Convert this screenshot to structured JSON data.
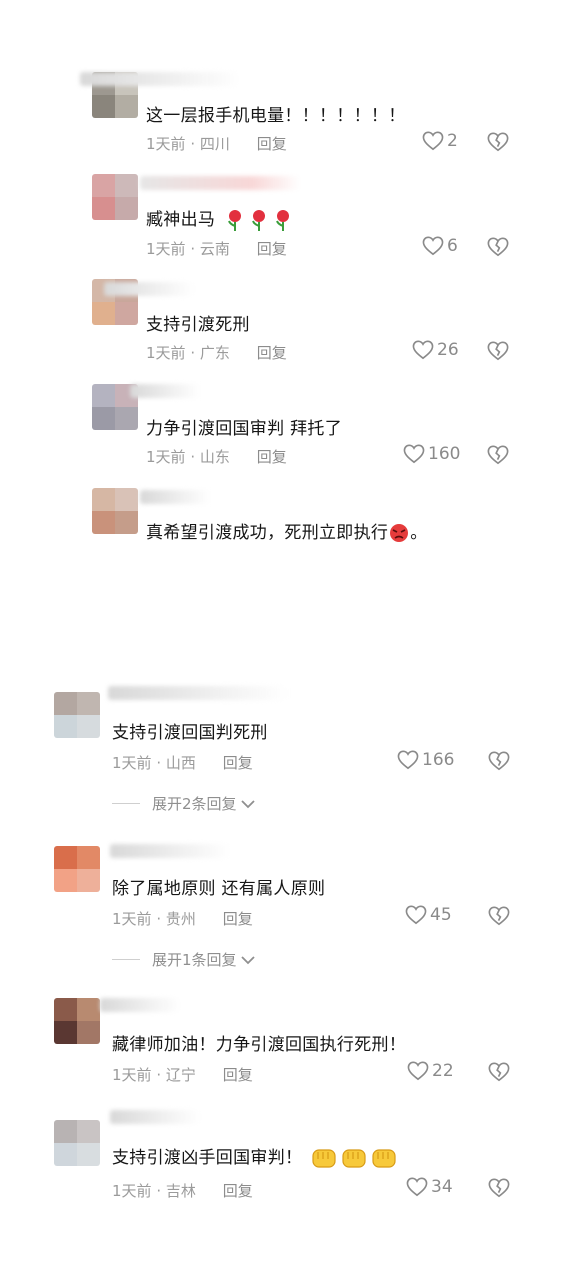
{
  "like_icon": "heart-outline-icon",
  "dislike_icon": "broken-heart-icon",
  "comments_top": [
    {
      "text": "这一层报手机电量！！！！！！！",
      "time": "1天前",
      "location": "四川",
      "reply": "回复",
      "likes": "2"
    },
    {
      "text": "臧神出马",
      "emoji": "rose",
      "time": "1天前",
      "location": "云南",
      "reply": "回复",
      "likes": "6"
    },
    {
      "text": "支持引渡死刑",
      "time": "1天前",
      "location": "广东",
      "reply": "回复",
      "likes": "26"
    },
    {
      "text": "力争引渡回国审判 拜托了",
      "time": "1天前",
      "location": "山东",
      "reply": "回复",
      "likes": "160"
    },
    {
      "text": "真希望引渡成功，死刑立即执行",
      "text_suffix": "。",
      "emoji": "angry-face"
    }
  ],
  "comments_bottom": [
    {
      "text": "支持引渡回国判死刑",
      "time": "1天前",
      "location": "山西",
      "reply": "回复",
      "likes": "166",
      "expand": "展开2条回复"
    },
    {
      "text": "除了属地原则 还有属人原则",
      "time": "1天前",
      "location": "贵州",
      "reply": "回复",
      "likes": "45",
      "expand": "展开1条回复"
    },
    {
      "text": "藏律师加油！力争引渡回国执行死刑！",
      "time": "1天前",
      "location": "辽宁",
      "reply": "回复",
      "likes": "22"
    },
    {
      "text": "支持引渡凶手回国审判！",
      "emoji": "fist",
      "time": "1天前",
      "location": "吉林",
      "reply": "回复",
      "likes": "34"
    }
  ],
  "sep": "·"
}
